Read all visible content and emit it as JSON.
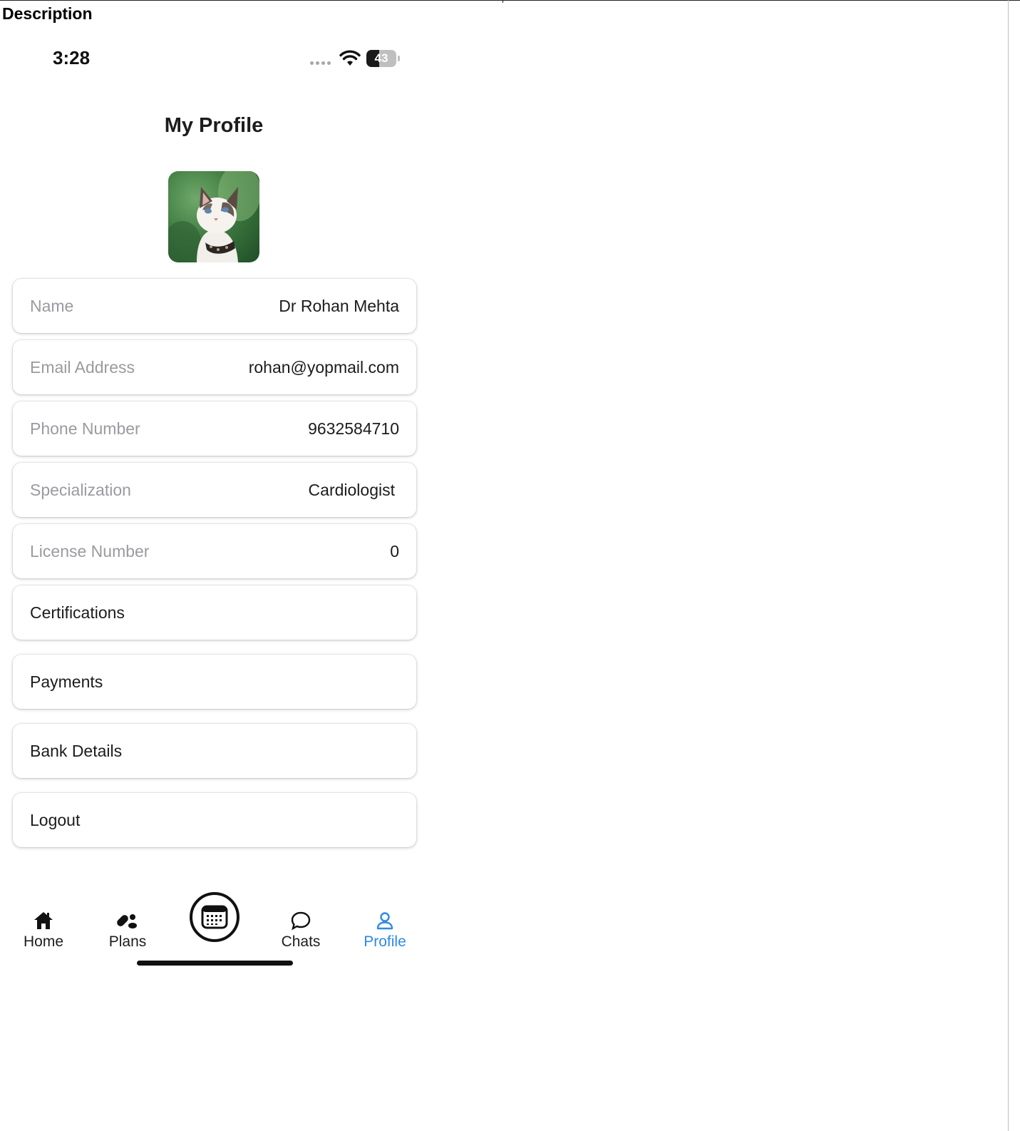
{
  "document": {
    "heading": "Description"
  },
  "status_bar": {
    "time": "3:28",
    "battery_level": "43",
    "battery_fraction": 0.43
  },
  "header": {
    "title": "My Profile"
  },
  "avatar": {
    "alt": "profile photo of a cat"
  },
  "profile_fields": [
    {
      "label": "Name",
      "value": "Dr Rohan Mehta"
    },
    {
      "label": "Email Address",
      "value": "rohan@yopmail.com"
    },
    {
      "label": "Phone Number",
      "value": "9632584710"
    },
    {
      "label": "Specialization",
      "value": "Cardiologist"
    },
    {
      "label": "License Number",
      "value": "0"
    }
  ],
  "menu": {
    "certifications": "Certifications",
    "payments": "Payments",
    "bank_details": "Bank Details",
    "logout": "Logout"
  },
  "bottom_nav": {
    "home": "Home",
    "plans": "Plans",
    "chats": "Chats",
    "profile": "Profile",
    "active": "profile",
    "active_color": "#2d8ae6"
  }
}
